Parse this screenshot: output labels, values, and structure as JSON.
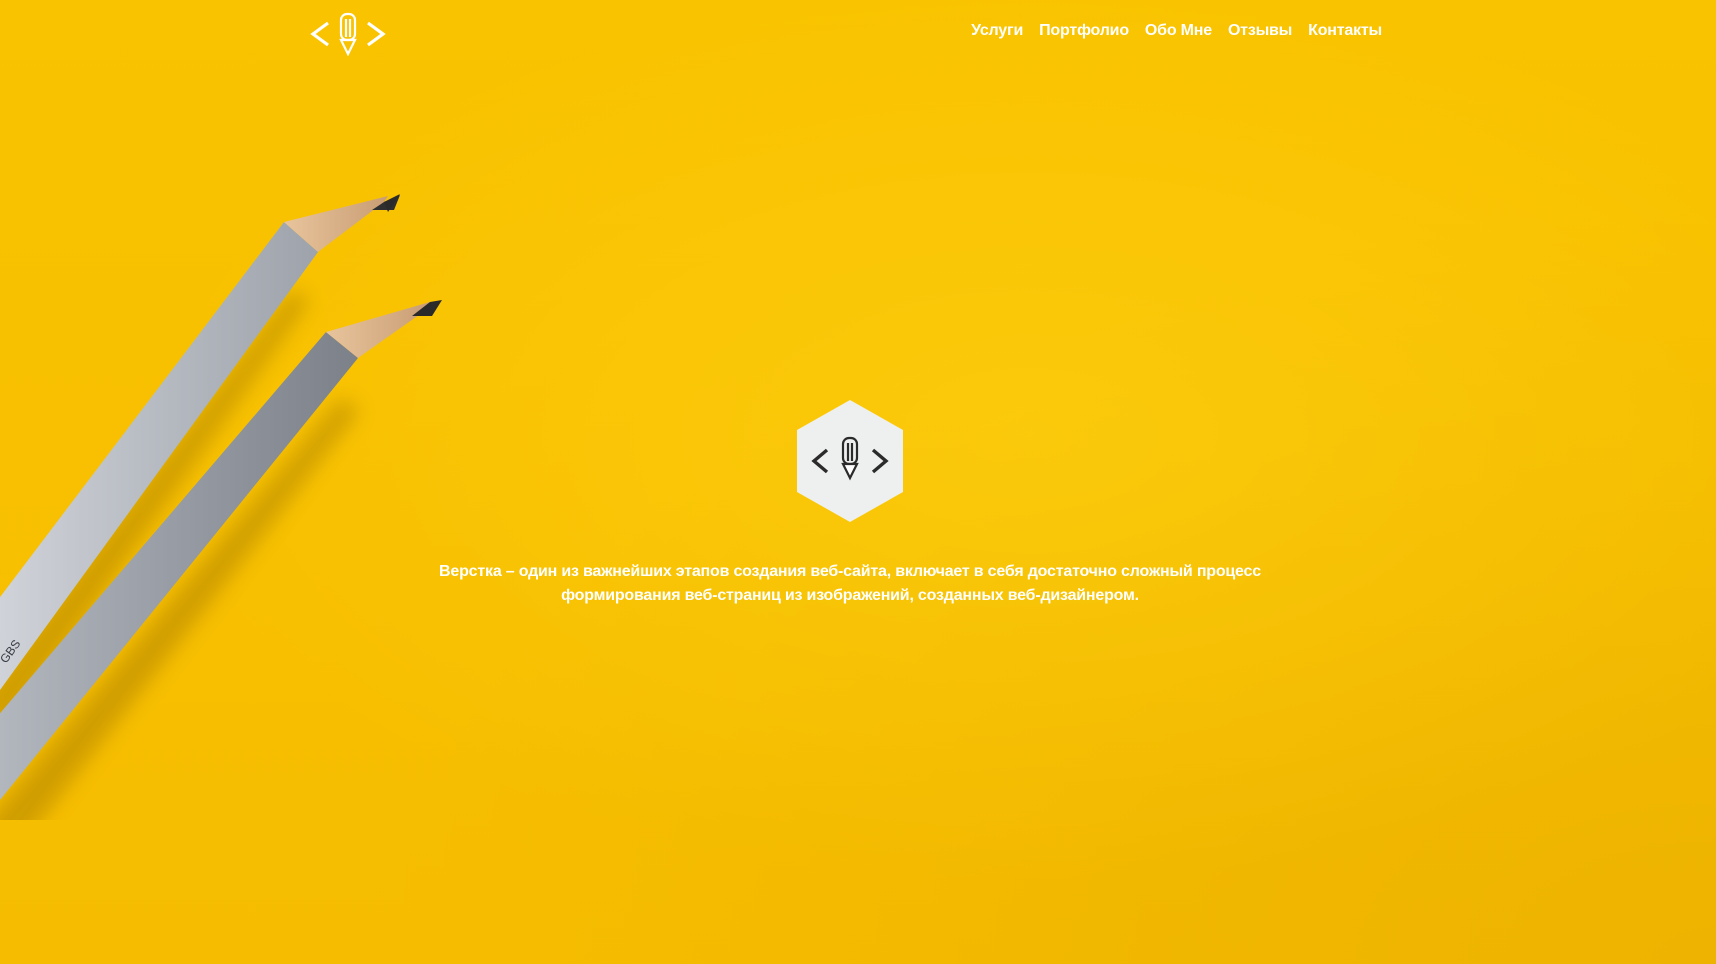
{
  "header": {
    "logo_icon": "code-pencil-logo-icon",
    "nav": [
      {
        "label": "Услуги"
      },
      {
        "label": "Портфолио"
      },
      {
        "label": "Обо Мне"
      },
      {
        "label": "Отзывы"
      },
      {
        "label": "Контакты"
      }
    ]
  },
  "hero": {
    "badge_icon": "hexagon-code-pencil-icon",
    "text": "Верстка – один из важнейших этапов создания веб-сайта, включает в себя достаточно сложный процесс формирования веб-страниц из изображений, созданных веб-дизайнером."
  },
  "colors": {
    "background": "#f7c100",
    "text": "#ffffff",
    "badge_fill": "#eef0f0",
    "badge_icon": "#2b2b2b"
  },
  "background_image": "two-pencils-image"
}
